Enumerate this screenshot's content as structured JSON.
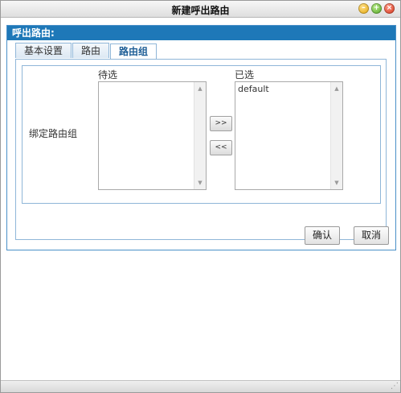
{
  "window": {
    "title": "新建呼出路由"
  },
  "panel": {
    "header": "呼出路由:"
  },
  "tabs": [
    {
      "label": "基本设置"
    },
    {
      "label": "路由"
    },
    {
      "label": "路由组"
    }
  ],
  "active_tab": "路由组",
  "binding": {
    "label": "绑定路由组",
    "available_title": "待选",
    "selected_title": "已选",
    "available_items": [],
    "selected_items": [
      "default"
    ],
    "add_label": ">>",
    "remove_label": "<<"
  },
  "footer": {
    "confirm_label": "确认",
    "cancel_label": "取消"
  },
  "colors": {
    "panel_header": "#1e78b8",
    "border_accent": "#4a90c8"
  }
}
